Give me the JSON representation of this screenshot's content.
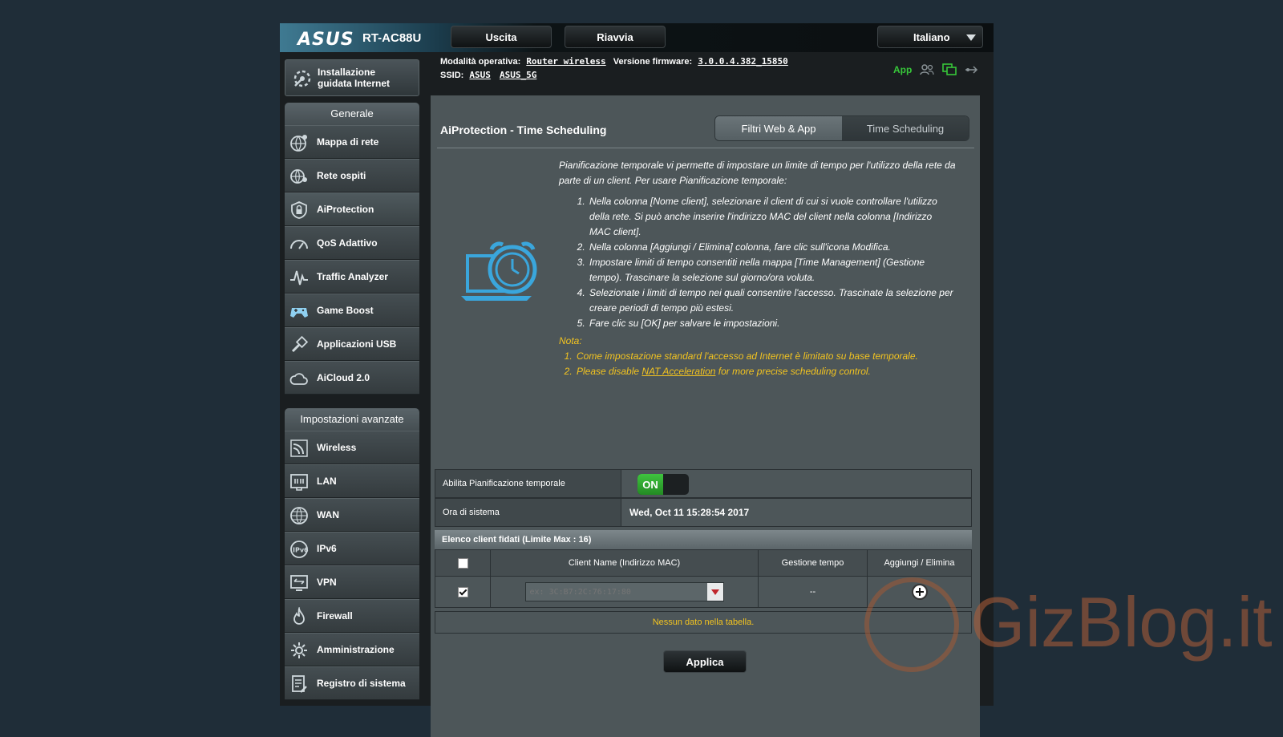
{
  "header": {
    "brand": "ASUS",
    "model": "RT-AC88U",
    "logout_label": "Uscita",
    "reboot_label": "Riavvia",
    "language": "Italiano"
  },
  "info": {
    "mode_label": "Modalità operativa:",
    "mode_value": "Router wireless",
    "fw_label": "Versione firmware:",
    "fw_value": "3.0.0.4.382_15850",
    "ssid_label": "SSID:",
    "ssid_1": "ASUS",
    "ssid_2": "ASUS_5G",
    "app_label": "App"
  },
  "sidebar": {
    "wizard_label_1": "Installazione",
    "wizard_label_2": "guidata Internet",
    "general_title": "Generale",
    "general_items": [
      {
        "label": "Mappa di rete",
        "icon": "network-map-icon"
      },
      {
        "label": "Rete ospiti",
        "icon": "guest-network-icon"
      },
      {
        "label": "AiProtection",
        "icon": "shield-lock-icon"
      },
      {
        "label": "QoS Adattivo",
        "icon": "speedometer-icon"
      },
      {
        "label": "Traffic Analyzer",
        "icon": "traffic-analyzer-icon"
      },
      {
        "label": "Game Boost",
        "icon": "gamepad-icon"
      },
      {
        "label": "Applicazioni USB",
        "icon": "usb-icon"
      },
      {
        "label": "AiCloud 2.0",
        "icon": "cloud-icon"
      }
    ],
    "advanced_title": "Impostazioni avanzate",
    "advanced_items": [
      {
        "label": "Wireless",
        "icon": "wifi-icon"
      },
      {
        "label": "LAN",
        "icon": "lan-icon"
      },
      {
        "label": "WAN",
        "icon": "globe-icon"
      },
      {
        "label": "IPv6",
        "icon": "ipv6-icon"
      },
      {
        "label": "VPN",
        "icon": "vpn-icon"
      },
      {
        "label": "Firewall",
        "icon": "firewall-icon"
      },
      {
        "label": "Amministrazione",
        "icon": "gear-icon"
      },
      {
        "label": "Registro di sistema",
        "icon": "log-icon"
      }
    ]
  },
  "main": {
    "title": "AiProtection - Time Scheduling",
    "tabs": [
      "Filtri Web & App",
      "Time Scheduling"
    ],
    "intro": "Pianificazione temporale vi permette di impostare un limite di tempo per l'utilizzo della rete da parte di un client. Per usare Pianificazione temporale:",
    "steps": [
      "Nella colonna [Nome client], selezionare il client di cui si vuole controllare l'utilizzo della rete. Si può anche inserire l'indirizzo MAC del client nella colonna [Indirizzo MAC client].",
      "Nella colonna [Aggiungi / Elimina] colonna, fare clic sull'icona Modifica.",
      "Impostare limiti di tempo consentiti nella mappa [Time Management] (Gestione tempo). Trascinare la selezione sul giorno/ora voluta.",
      "Selezionate i limiti di tempo nei quali consentire l'accesso. Trascinate la selezione per creare periodi di tempo più estesi.",
      "Fare clic su [OK] per salvare le impostazioni."
    ],
    "note_title": "Nota:",
    "note_1": "Come impostazione standard l'accesso ad Internet è limitato su base temporale.",
    "note_2_pre": "Please disable ",
    "note_2_link": "NAT Acceleration",
    "note_2_post": " for more precise scheduling control.",
    "enable_label": "Abilita Pianificazione temporale",
    "enable_value": "ON",
    "time_label": "Ora di sistema",
    "time_value": "Wed, Oct 11 15:28:54 2017",
    "client_list_title": "Elenco client fidati (Limite Max : 16)",
    "columns": [
      "Client Name (Indirizzo MAC)",
      "Gestione tempo",
      "Aggiungi / Elimina"
    ],
    "mac_placeholder": "ex: 3C:B7:2C:76:17:80",
    "time_mgmt_value": "--",
    "no_data": "Nessun dato nella tabella.",
    "apply_label": "Applica"
  },
  "watermark": "GizBlog.it",
  "colors": {
    "accent_green": "#37c83a",
    "note_yellow": "#f2c320",
    "watermark": "#b25f38"
  }
}
